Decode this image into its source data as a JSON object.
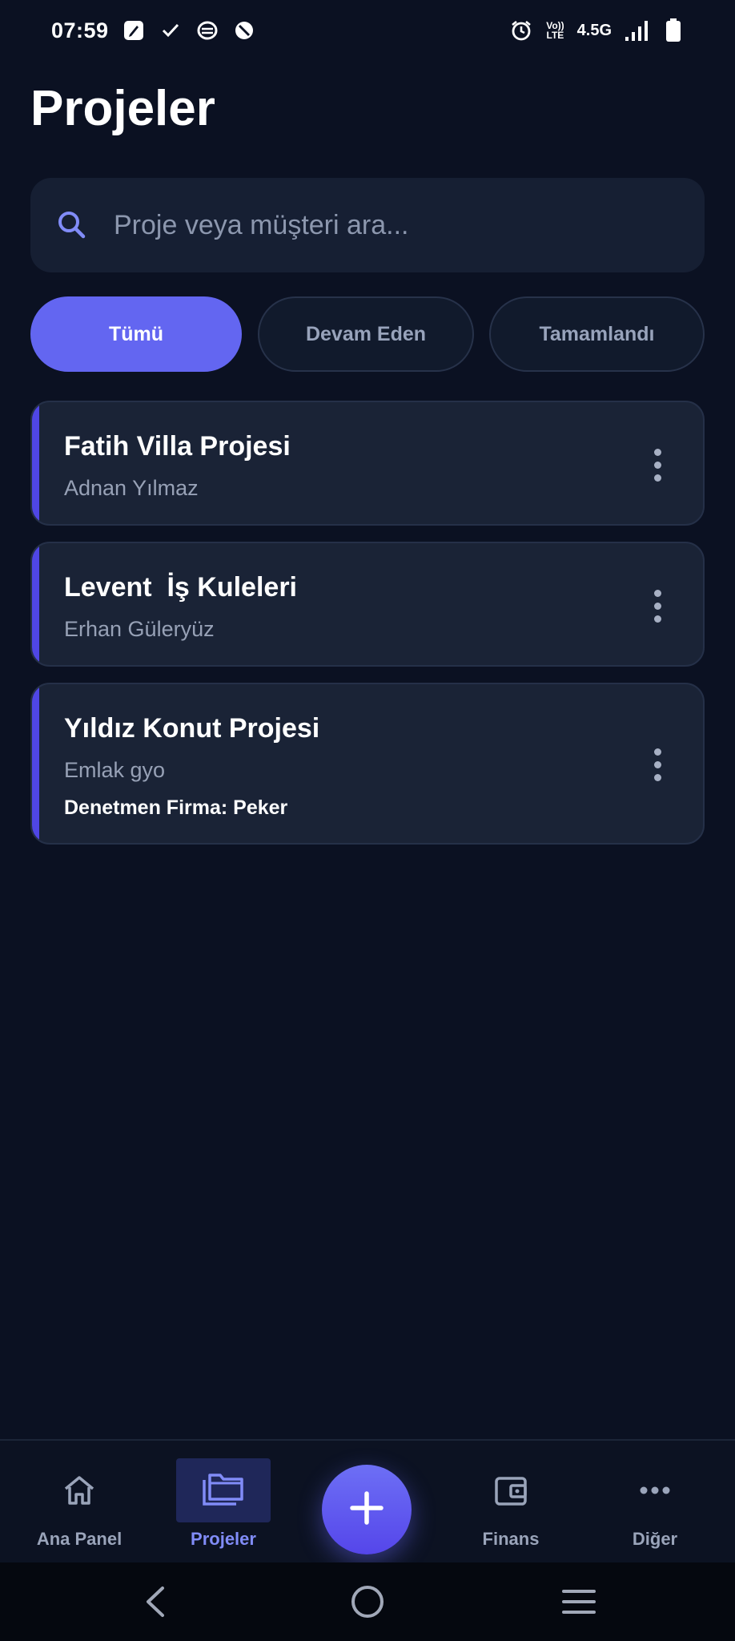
{
  "status_bar": {
    "time": "07:59",
    "left_icons": [
      "pen-note-icon",
      "check-icon",
      "app-notification-icon",
      "blocked-icon"
    ],
    "right_icons": [
      "alarm-icon",
      "volte-icon",
      "signal-icon",
      "battery-icon"
    ],
    "volte_top": "Vo))",
    "volte_bottom": "LTE",
    "network": "4.5G"
  },
  "page": {
    "title": "Projeler"
  },
  "search": {
    "placeholder": "Proje veya müşteri ara...",
    "value": "",
    "icon": "search-icon"
  },
  "filters": {
    "items": [
      {
        "label": "Tümü",
        "active": true
      },
      {
        "label": "Devam Eden",
        "active": false
      },
      {
        "label": "Tamamlandı",
        "active": false
      }
    ]
  },
  "projects": [
    {
      "title": "Fatih Villa Projesi",
      "client": "Adnan Yılmaz"
    },
    {
      "title": "Levent  İş Kuleleri",
      "client": "Erhan Güleryüz"
    },
    {
      "title": "Yıldız Konut Projesi",
      "client": "Emlak gyo",
      "extra": "Denetmen Firma: Peker"
    }
  ],
  "bottom_nav": {
    "items": [
      {
        "label": "Ana Panel",
        "icon": "home-icon",
        "active": false
      },
      {
        "label": "Projeler",
        "icon": "folders-icon",
        "active": true
      },
      {
        "label": "Finans",
        "icon": "wallet-icon",
        "active": false
      },
      {
        "label": "Diğer",
        "icon": "more-horizontal-icon",
        "active": false
      }
    ],
    "fab_icon": "plus-icon"
  },
  "system_nav": {
    "icons": [
      "back-icon",
      "home-circle-icon",
      "menu-icon"
    ]
  },
  "colors": {
    "background": "#0b1122",
    "card": "#1a2336",
    "accent": "#6366f1",
    "card_accent": "#4f46e5",
    "muted_text": "#97a1b6"
  }
}
